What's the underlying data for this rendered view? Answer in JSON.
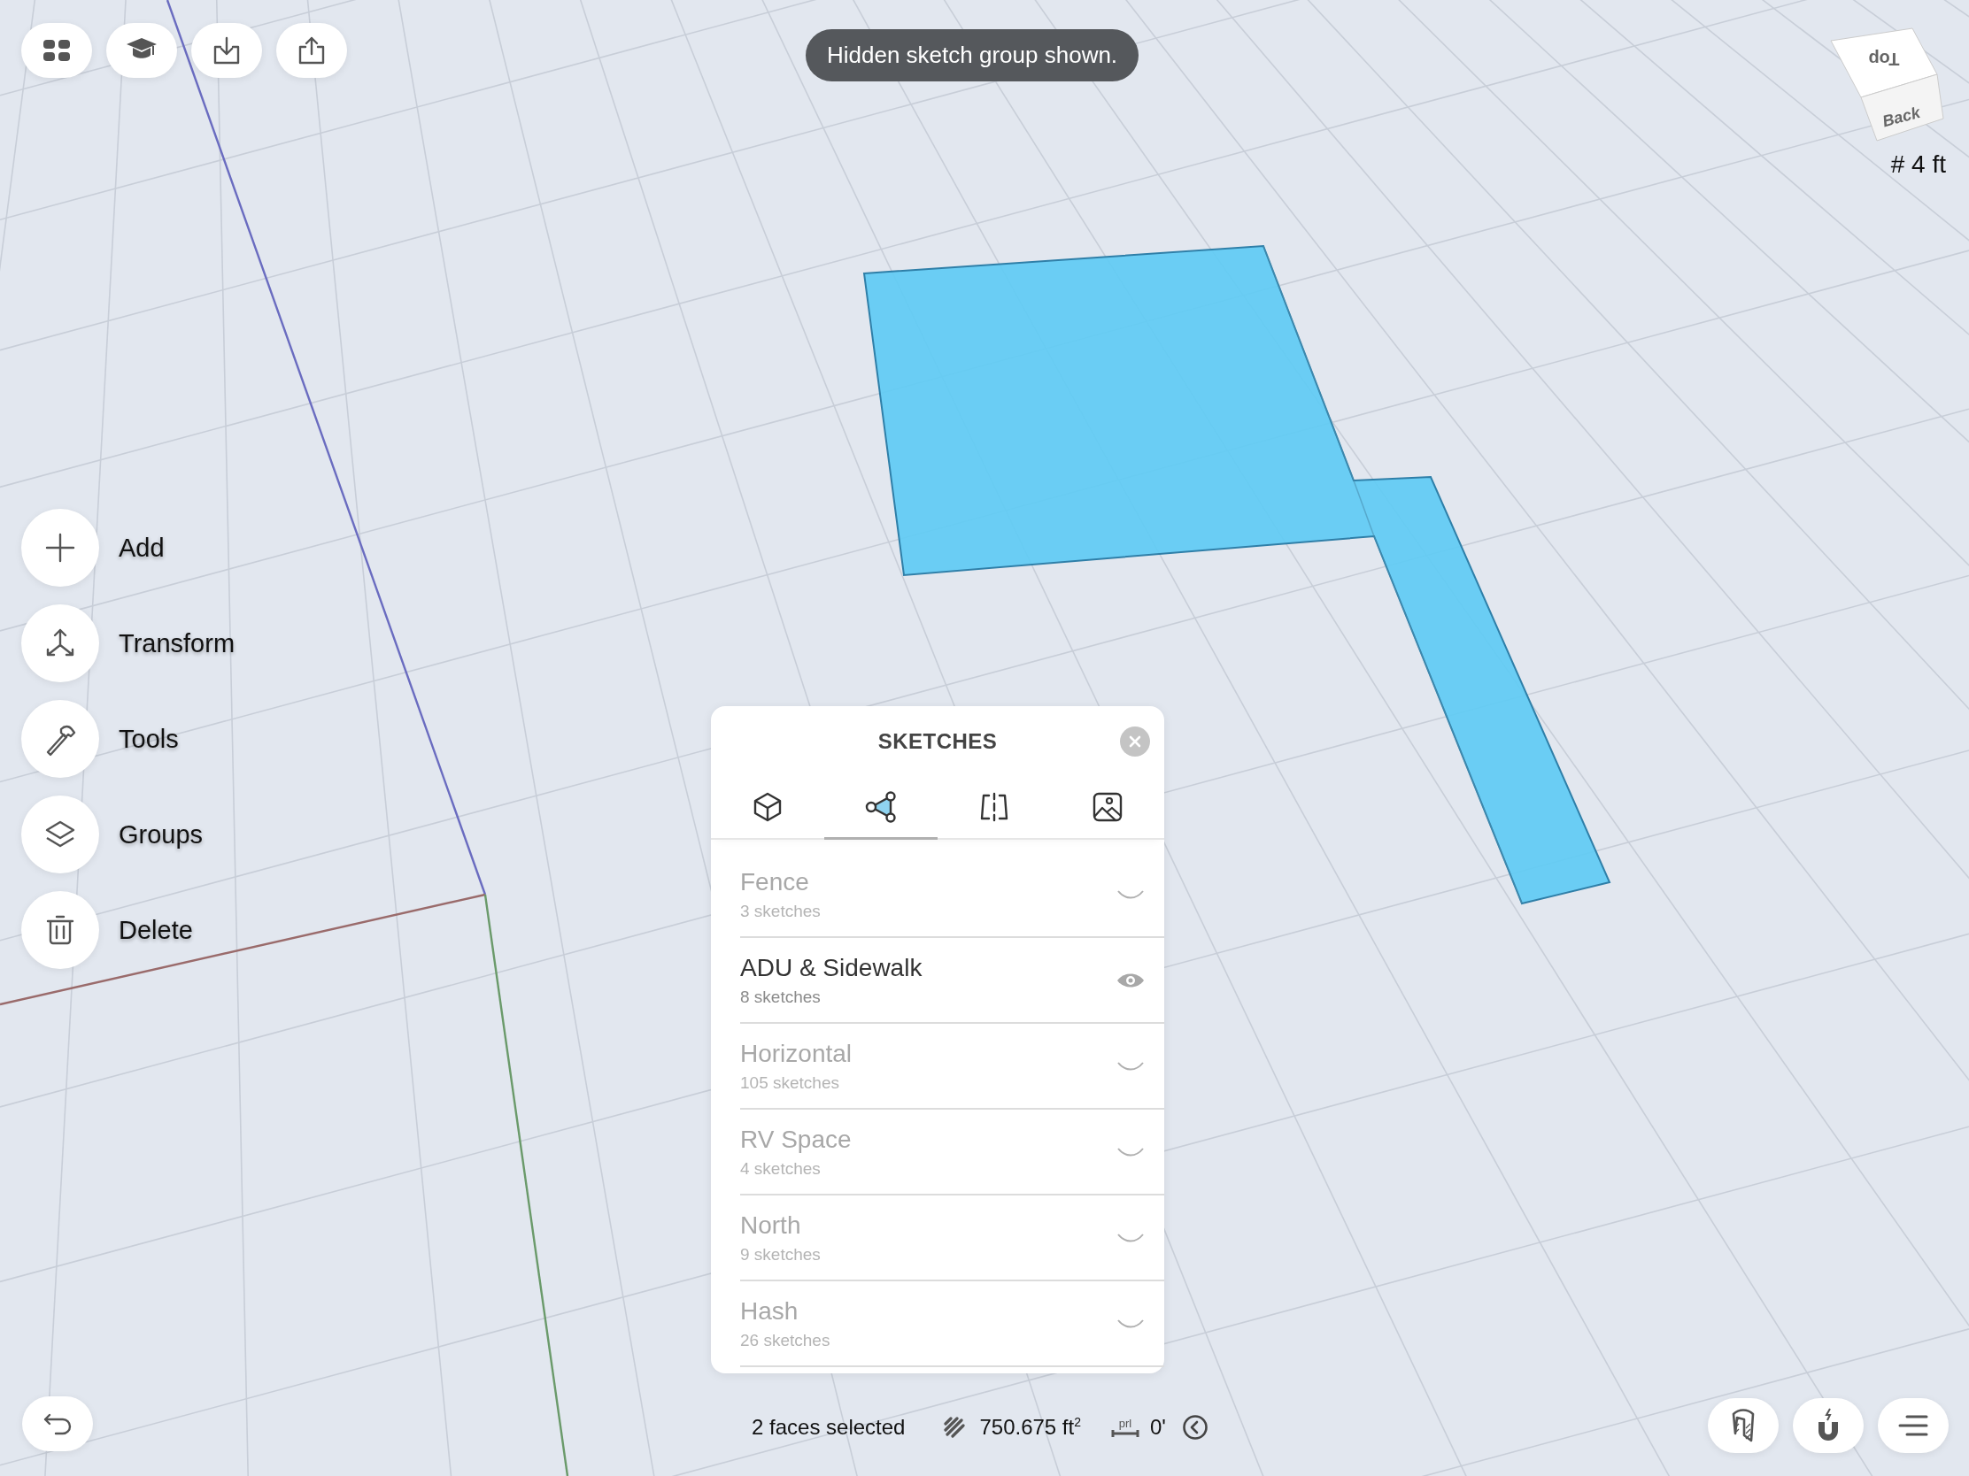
{
  "toast": "Hidden sketch group shown.",
  "view_cube": {
    "top": "Top",
    "side": "Back"
  },
  "grid_size": "# 4 ft",
  "side_menu": [
    {
      "label": "Add"
    },
    {
      "label": "Transform"
    },
    {
      "label": "Tools"
    },
    {
      "label": "Groups"
    },
    {
      "label": "Delete"
    }
  ],
  "sketches_panel": {
    "title": "SKETCHES",
    "tabs": [
      {
        "selected": false
      },
      {
        "selected": true
      },
      {
        "selected": false
      },
      {
        "selected": false
      }
    ],
    "groups": [
      {
        "name": "Fence",
        "count": "3 sketches",
        "visible": false
      },
      {
        "name": "ADU & Sidewalk",
        "count": "8 sketches",
        "visible": true
      },
      {
        "name": "Horizontal",
        "count": "105 sketches",
        "visible": false
      },
      {
        "name": "RV Space",
        "count": "4 sketches",
        "visible": false
      },
      {
        "name": "North",
        "count": "9 sketches",
        "visible": false
      },
      {
        "name": "Hash",
        "count": "26 sketches",
        "visible": false
      }
    ]
  },
  "status_bar": {
    "selection": "2 faces selected",
    "area": "750.675 ft$^{2}$",
    "offset_label": "prl",
    "offset": "0'"
  }
}
